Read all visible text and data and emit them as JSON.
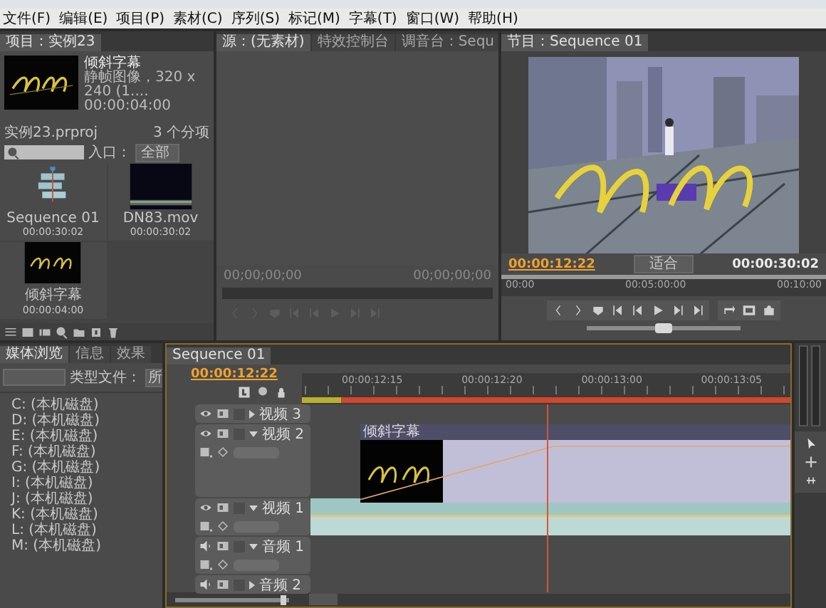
{
  "menu": [
    "文件(F)",
    "编辑(E)",
    "项目(P)",
    "素材(C)",
    "序列(S)",
    "标记(M)",
    "字幕(T)",
    "窗口(W)",
    "帮助(H)"
  ],
  "project": {
    "tab": "项目：实例23",
    "preview": {
      "name": "倾斜字幕",
      "info": "静帧图像，320 x 240 (1....",
      "duration": "00:00:04:00"
    },
    "file": "实例23.prproj",
    "count": "3 个分项",
    "entry_label": "入口：",
    "entry_value": "全部",
    "items": [
      {
        "name": "Sequence 01",
        "duration": "00:00:30:02",
        "kind": "sequence"
      },
      {
        "name": "DN83.mov",
        "duration": "00:00:30:02",
        "kind": "video"
      },
      {
        "name": "倾斜字幕",
        "duration": "00:00:04:00",
        "kind": "title"
      }
    ]
  },
  "source": {
    "tabs": [
      {
        "label": "源：(无素材)",
        "selected": true
      },
      {
        "label": "特效控制台",
        "selected": false
      },
      {
        "label": "调音台：Sequ",
        "selected": false
      }
    ],
    "timecode_in": "00;00;00;00",
    "timecode_out": "00;00;00;00"
  },
  "program": {
    "tab": "节目：Sequence 01",
    "timecode": "00:00:12:22",
    "zoom": "适合",
    "duration": "00:00:30:02",
    "ruler": [
      "00:00",
      "00:05:00:00",
      "00:10:00"
    ],
    "shuttle": {
      "level": 0.5
    }
  },
  "media_browser": {
    "tabs": [
      {
        "label": "媒体浏览",
        "selected": true
      },
      {
        "label": "信息",
        "selected": false
      },
      {
        "label": "效果",
        "selected": false
      }
    ],
    "type_label": "类型文件：",
    "type_value": "所",
    "drives": [
      "C: (本机磁盘)",
      "D: (本机磁盘)",
      "E: (本机磁盘)",
      "F: (本机磁盘)",
      "G: (本机磁盘)",
      "I: (本机磁盘)",
      "J: (本机磁盘)",
      "K: (本机磁盘)",
      "L: (本机磁盘)",
      "M: (本机磁盘)"
    ]
  },
  "timeline": {
    "tab": "Sequence 01",
    "timecode": "00:00:12:22",
    "zoom": {
      "level": 0.95
    },
    "ruler": [
      "00:00:12:15",
      "00:00:12:20",
      "00:00:13:00",
      "00:00:13:05"
    ],
    "tracks": [
      {
        "name": "视频 3",
        "kind": "video",
        "expanded": false
      },
      {
        "name": "视频 2",
        "kind": "video",
        "expanded": true,
        "clip": {
          "kind": "title",
          "name": "倾斜字幕"
        }
      },
      {
        "name": "视频 1",
        "kind": "video",
        "expanded": true,
        "clip": {
          "kind": "video"
        }
      },
      {
        "name": "音频 1",
        "kind": "audio",
        "expanded": true
      },
      {
        "name": "音频 2",
        "kind": "audio",
        "expanded": false
      }
    ]
  }
}
